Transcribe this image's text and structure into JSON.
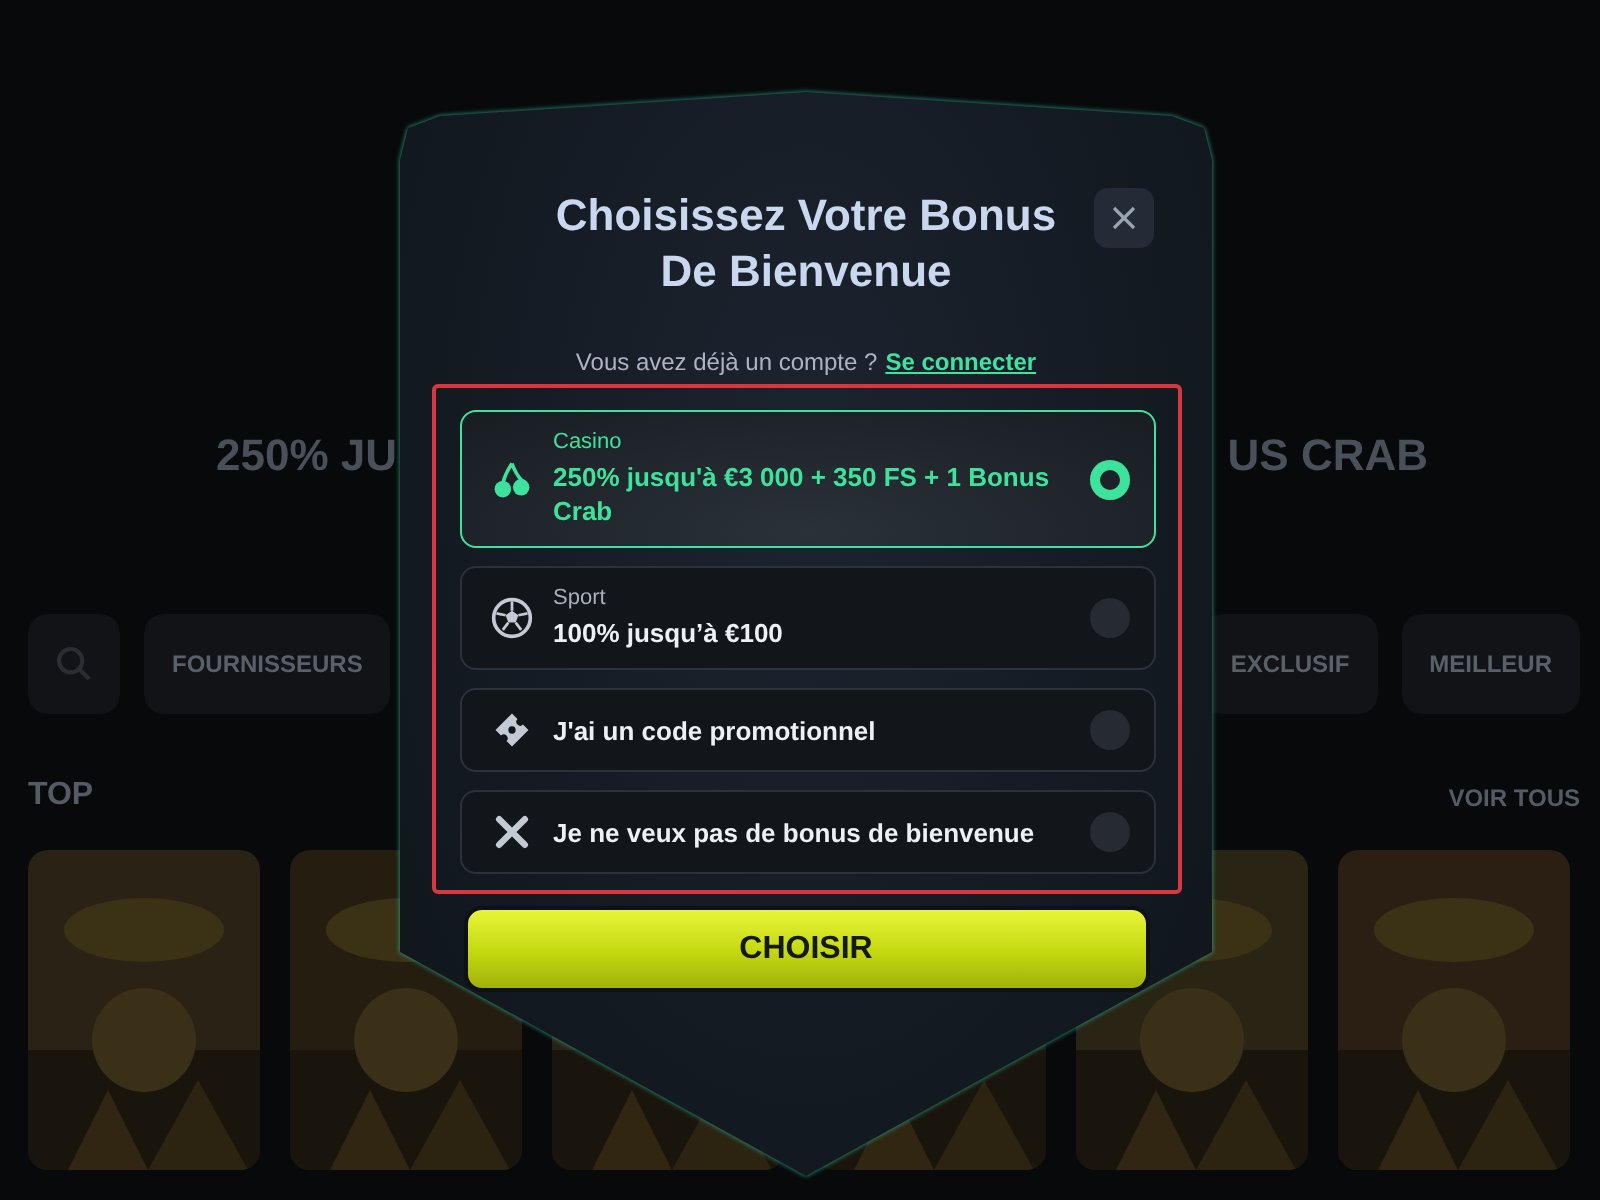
{
  "background": {
    "headline_left": "250% JU",
    "headline_right": "US CRAB",
    "filters_left": [
      {
        "label": "FOURNISSEURS"
      }
    ],
    "filters_right": [
      {
        "label": "EXCLUSIF"
      },
      {
        "label": "MEILLEUR"
      }
    ],
    "section_title": "TOP",
    "section_link": "VOIR TOUS"
  },
  "modal": {
    "title": "Choisissez Votre Bonus De Bienvenue",
    "account_prompt": "Vous avez déjà un compte ?",
    "login_link": "Se connecter",
    "options": [
      {
        "category": "Casino",
        "label": "250% jusqu'à €3 000 + 350 FS + 1 Bonus Crab",
        "selected": true
      },
      {
        "category": "Sport",
        "label": "100% jusqu’à €100",
        "selected": false
      },
      {
        "label": "J'ai un code promotionnel",
        "selected": false
      },
      {
        "label": "Je ne veux pas de bonus de bienvenue",
        "selected": false
      }
    ],
    "submit": "CHOISIR"
  }
}
